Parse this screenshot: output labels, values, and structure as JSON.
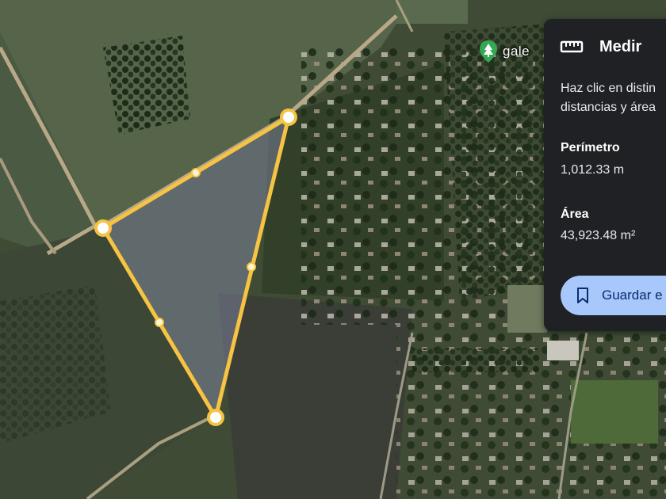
{
  "map": {
    "place_label": "gale",
    "place_icon": "tree-pin-icon",
    "polygon_stroke": "#f6c342",
    "polygon_fill": "#8a8fb0"
  },
  "panel": {
    "title": "Medir",
    "title_icon": "ruler-icon",
    "instruction_line1": "Haz clic en distin",
    "instruction_line2": "distancias y área",
    "perimeter_label": "Perímetro",
    "perimeter_value": "1,012.33 m",
    "area_label": "Área",
    "area_value": "43,923.48 m²",
    "save_button_label": "Guardar e",
    "save_button_icon": "bookmark-icon",
    "accent": "#a8c7fa"
  }
}
